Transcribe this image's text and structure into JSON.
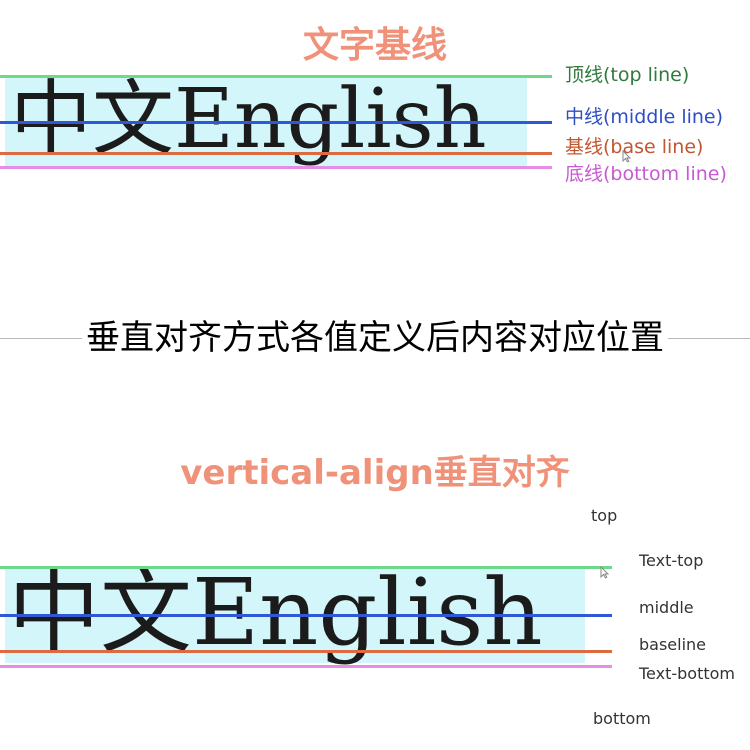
{
  "section1": {
    "title": "文字基线",
    "sample_text": "中文English",
    "labels": {
      "top": "顶线(top line)",
      "middle": "中线(middle line)",
      "base": "基线(base line)",
      "bottom": "底线(bottom line)"
    }
  },
  "heading": "垂直对齐方式各值定义后内容对应位置",
  "section2": {
    "title": "vertical-align垂直对齐",
    "sample_text": "中文English",
    "labels": {
      "top": "top",
      "text_top": "Text-top",
      "middle": "middle",
      "baseline": "baseline",
      "text_bottom": "Text-bottom",
      "bottom": "bottom"
    }
  },
  "colors": {
    "title": "#f0927a",
    "top_line": "#6fd98b",
    "middle_line": "#2f57d6",
    "base_line": "#de6a42",
    "bottom_line": "#e58ee3",
    "text_background": "#d2f6fa"
  },
  "icons": {
    "cursor": "mouse-pointer-icon"
  }
}
